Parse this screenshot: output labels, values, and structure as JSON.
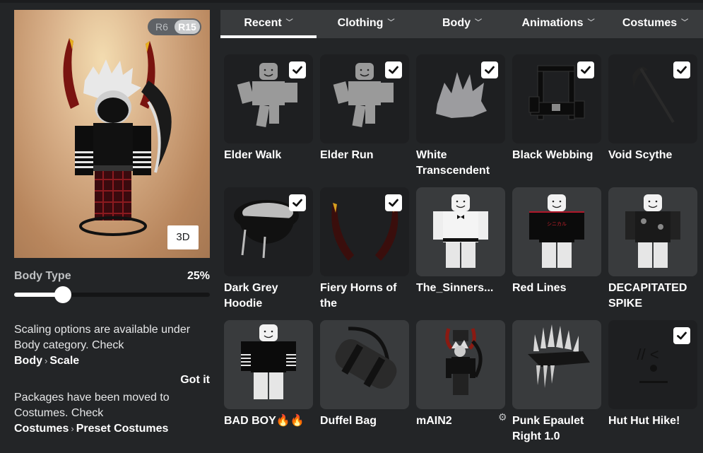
{
  "preview": {
    "rig_options": [
      "R6",
      "R15"
    ],
    "rig_selected": "R15",
    "view_button": "3D"
  },
  "body_type": {
    "label": "Body Type",
    "value_text": "25%",
    "value": 0.25
  },
  "tips": {
    "scaling": {
      "text": "Scaling options are available under Body category. Check",
      "path": [
        "Body",
        "Scale"
      ]
    },
    "got_it": "Got it",
    "packages": {
      "text": "Packages have been moved to Costumes. Check",
      "path": [
        "Costumes",
        "Preset Costumes"
      ]
    },
    "separator": "›"
  },
  "tabs": [
    {
      "label": "Recent",
      "active": true
    },
    {
      "label": "Clothing",
      "active": false
    },
    {
      "label": "Body",
      "active": false
    },
    {
      "label": "Animations",
      "active": false
    },
    {
      "label": "Costumes",
      "active": false
    }
  ],
  "items": [
    {
      "name": "Elder Walk",
      "equipped": true,
      "icon": "animation-figure",
      "bg": "dark"
    },
    {
      "name": "Elder Run",
      "equipped": true,
      "icon": "animation-figure",
      "bg": "dark"
    },
    {
      "name": "White Transcendent",
      "equipped": true,
      "icon": "hair",
      "bg": "dark"
    },
    {
      "name": "Black Webbing",
      "equipped": true,
      "icon": "harness",
      "bg": "dark"
    },
    {
      "name": "Void Scythe",
      "equipped": true,
      "icon": "scythe",
      "bg": "dark"
    },
    {
      "name": "Dark Grey Hoodie",
      "equipped": true,
      "icon": "hood",
      "bg": "dark"
    },
    {
      "name": "Fiery Horns of the",
      "equipped": true,
      "icon": "horns",
      "bg": "dark"
    },
    {
      "name": "The_Sinners...",
      "equipped": false,
      "icon": "shirt-white",
      "bg": "light"
    },
    {
      "name": "Red Lines",
      "equipped": false,
      "icon": "shirt-black-red",
      "bg": "light"
    },
    {
      "name": "DECAPITATED SPIKE",
      "equipped": false,
      "icon": "shirt-black-print",
      "bg": "light"
    },
    {
      "name": "BAD BOY🔥🔥",
      "equipped": false,
      "icon": "shirt-striped",
      "bg": "light"
    },
    {
      "name": "Duffel Bag",
      "equipped": false,
      "icon": "bag",
      "bg": "light"
    },
    {
      "name": "mAIN2",
      "equipped": false,
      "icon": "outfit-avatar",
      "bg": "light",
      "has_settings": true
    },
    {
      "name": "Punk Epaulet Right 1.0",
      "equipped": false,
      "icon": "spiked-epaulet",
      "bg": "light"
    },
    {
      "name": "Hut Hut Hike!",
      "equipped": true,
      "icon": "face",
      "bg": "dark"
    }
  ],
  "icons": {
    "check": "checkmark-icon",
    "gear": "⚙",
    "chevron": "⌄"
  }
}
